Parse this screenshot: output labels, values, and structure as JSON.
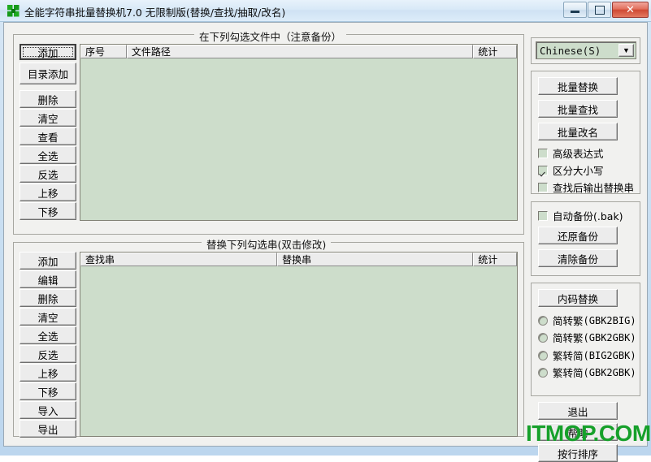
{
  "window": {
    "title": "全能字符串批量替换机7.0 无限制版(替换/查找/抽取/改名)",
    "icon": "app-puzzle-icon",
    "minimize_label": "—",
    "maximize_label": "□",
    "close_label": "✕"
  },
  "files_group": {
    "title": "在下列勾选文件中（注意备份）",
    "buttons": [
      {
        "label": "添加",
        "focused": true
      },
      {
        "label": "目录添加",
        "focused": false
      },
      {
        "label": "删除",
        "focused": false
      },
      {
        "label": "清空",
        "focused": false
      },
      {
        "label": "查看",
        "focused": false
      },
      {
        "label": "全选",
        "focused": false
      },
      {
        "label": "反选",
        "focused": false
      },
      {
        "label": "上移",
        "focused": false
      },
      {
        "label": "下移",
        "focused": false
      }
    ],
    "columns": [
      "序号",
      "文件路径",
      "统计"
    ],
    "rows": []
  },
  "rules_group": {
    "title": "替换下列勾选串(双击修改)",
    "buttons": [
      {
        "label": "添加"
      },
      {
        "label": "编辑"
      },
      {
        "label": "删除"
      },
      {
        "label": "清空"
      },
      {
        "label": "全选"
      },
      {
        "label": "反选"
      },
      {
        "label": "上移"
      },
      {
        "label": "下移"
      },
      {
        "label": "导入"
      },
      {
        "label": "导出"
      }
    ],
    "columns": [
      "查找串",
      "替换串",
      "统计"
    ],
    "rows": []
  },
  "language_group": {
    "selected": "Chinese(S)",
    "arrow_glyph": "▼"
  },
  "actions_group": {
    "buttons": [
      {
        "label": "批量替换"
      },
      {
        "label": "批量查找"
      },
      {
        "label": "批量改名"
      }
    ],
    "checkboxes": [
      {
        "label": "高级表达式",
        "checked": false
      },
      {
        "label": "区分大小写",
        "checked": true
      },
      {
        "label": "查找后输出替换串",
        "checked": false
      }
    ]
  },
  "backup_group": {
    "checkbox": {
      "label": "自动备份(.bak)",
      "checked": false
    },
    "buttons": [
      {
        "label": "还原备份"
      },
      {
        "label": "清除备份"
      }
    ]
  },
  "encoding_group": {
    "button": {
      "label": "内码替换"
    },
    "radios": [
      {
        "cn": "简转繁",
        "code": "(GBK2BIG)",
        "selected": false
      },
      {
        "cn": "简转繁",
        "code": "(GBK2GBK)",
        "selected": false
      },
      {
        "cn": "繁转简",
        "code": "(BIG2GBK)",
        "selected": false
      },
      {
        "cn": "繁转简",
        "code": "(GBK2GBK)",
        "selected": false
      }
    ]
  },
  "bottom_buttons": [
    {
      "label": "退出"
    },
    {
      "label": "帮助"
    },
    {
      "label": "按行排序"
    }
  ],
  "watermark": {
    "text": "ITMOP.COM",
    "color": "#16a02a"
  },
  "colors": {
    "list_background": "#cdddcb",
    "button_face": "#ececec",
    "client_background": "#f1f1ef",
    "frame_blue": "#cbe0f2"
  }
}
